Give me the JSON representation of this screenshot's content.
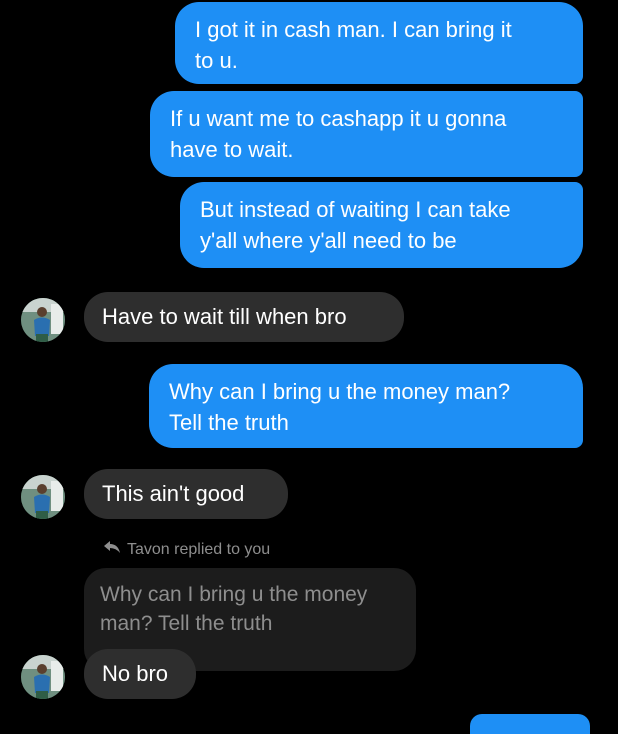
{
  "conversation": {
    "messages": [
      {
        "id": "m1",
        "direction": "outgoing",
        "text": "I got it in cash man. I can bring it\nto u."
      },
      {
        "id": "m2",
        "direction": "outgoing",
        "text": "If u want me to cashapp it u gonna\nhave to wait."
      },
      {
        "id": "m3",
        "direction": "outgoing",
        "text": "But instead of waiting I can take\ny'all where y'all need to be"
      },
      {
        "id": "m4",
        "direction": "incoming",
        "text": "Have to wait till when bro"
      },
      {
        "id": "m5",
        "direction": "outgoing",
        "text": "Why can I bring u the money man?\nTell the truth"
      },
      {
        "id": "m6",
        "direction": "incoming",
        "text": "This ain't good"
      },
      {
        "id": "m7",
        "direction": "incoming",
        "text": "No bro"
      }
    ],
    "reply": {
      "label": "Tavon replied to you",
      "quoted_text": "Why can I bring u the money\nman? Tell the truth"
    }
  },
  "icons": {
    "reply": "reply-arrow-icon",
    "avatar": "contact-avatar"
  },
  "colors": {
    "background": "#000000",
    "outgoing_bubble": "#1e8ff5",
    "incoming_bubble": "#2e2e2e",
    "reply_quote_bubble": "#1c1c1c",
    "muted_text": "#8e8e8e"
  }
}
